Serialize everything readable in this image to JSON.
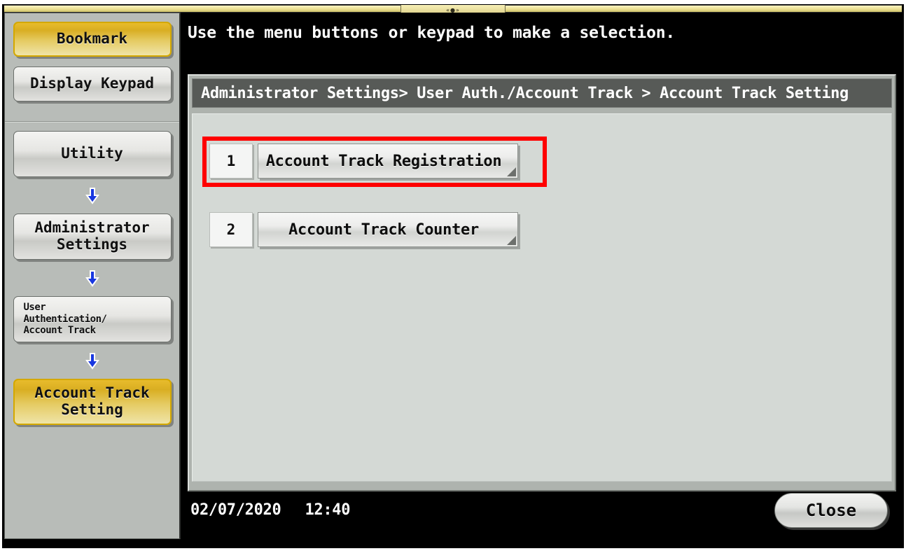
{
  "device": {
    "status_strip_indicator": "«●»"
  },
  "sidebar": {
    "top_items": [
      {
        "label": "Bookmark",
        "state": "selected"
      },
      {
        "label": "Display Keypad",
        "state": "normal"
      }
    ],
    "nav_items": [
      {
        "label": "Utility",
        "state": "normal"
      },
      {
        "label": "Administrator\nSettings",
        "state": "normal"
      },
      {
        "label": "User\nAuthentication/\nAccount Track",
        "state": "normal"
      },
      {
        "label": "Account Track\nSetting",
        "state": "selected"
      }
    ],
    "arrow_icon": "arrow-down-icon"
  },
  "main": {
    "instruction": "Use the menu buttons or keypad to make a selection.",
    "breadcrumb": "Administrator Settings> User Auth./Account Track > Account Track Setting",
    "menu_items": [
      {
        "number": "1",
        "label": "Account Track Registration",
        "highlighted": true
      },
      {
        "number": "2",
        "label": "Account Track Counter",
        "highlighted": false
      }
    ]
  },
  "footer": {
    "date": "02/07/2020",
    "time": "12:40",
    "close_label": "Close"
  },
  "colors": {
    "highlight_red": "#ff0000",
    "selected_gold": "#e8bc2c",
    "panel_bg": "#d4d9d5",
    "breadcrumb_bg": "#575a57",
    "arrow_blue": "#1938e0"
  }
}
